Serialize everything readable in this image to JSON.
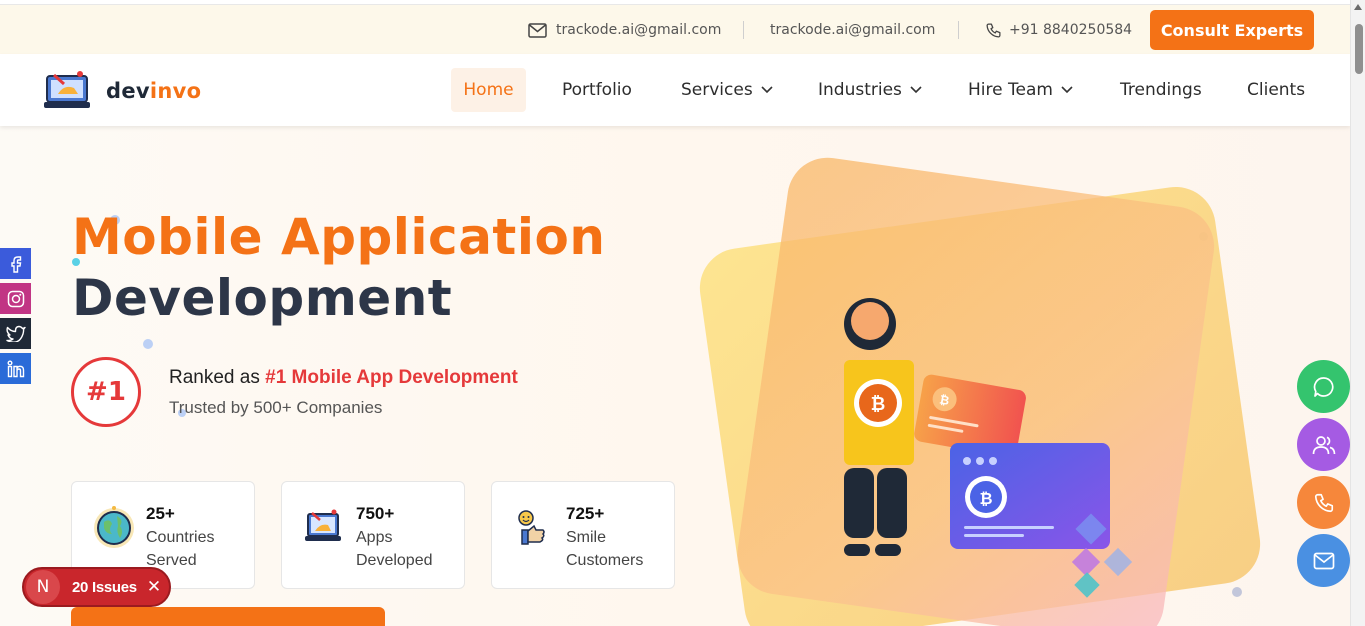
{
  "topbar": {
    "email1": "trackode.ai@gmail.com",
    "email2": "trackode.ai@gmail.com",
    "phone": "+91 8840250584",
    "cta_label": "Consult Experts"
  },
  "nav": {
    "logo_dev": "dev",
    "logo_invo": "invo",
    "items": [
      {
        "label": "Home"
      },
      {
        "label": "Portfolio"
      },
      {
        "label": "Services"
      },
      {
        "label": "Industries"
      },
      {
        "label": "Hire Team"
      },
      {
        "label": "Trendings"
      },
      {
        "label": "Clients"
      }
    ]
  },
  "hero": {
    "title_line1": "Mobile Application",
    "title_line2": "Development",
    "rank_badge": "#1",
    "rank_prefix": "Ranked as ",
    "rank_highlight": "#1 Mobile App Development",
    "rank_sub": "Trusted by 500+ Companies"
  },
  "stats": [
    {
      "value": "25+",
      "line1": "Countries",
      "line2": "Served",
      "icon": "globe-icon"
    },
    {
      "value": "750+",
      "line1": "Apps",
      "line2": "Developed",
      "icon": "laptop-icon"
    },
    {
      "value": "725+",
      "line1": "Smile",
      "line2": "Customers",
      "icon": "thumbs-up-icon"
    }
  ],
  "social": [
    "facebook-icon",
    "instagram-icon",
    "twitter-icon",
    "linkedin-icon"
  ],
  "floating_actions": [
    "chat-icon",
    "team-icon",
    "phone-icon",
    "mail-icon"
  ],
  "issues": {
    "badge": "N",
    "label": "20 Issues"
  },
  "colors": {
    "brand_orange": "#f47216",
    "dark_navy": "#2d3648",
    "accent_red": "#e5393a",
    "facebook": "#3b5bdb",
    "instagram": "#c13584",
    "twitter": "#1f2937",
    "linkedin": "#2a6bd8",
    "chat_green": "#34c46e",
    "team_purple": "#a55be3",
    "phone_orange": "#f6873b",
    "mail_blue": "#4a90e2"
  }
}
